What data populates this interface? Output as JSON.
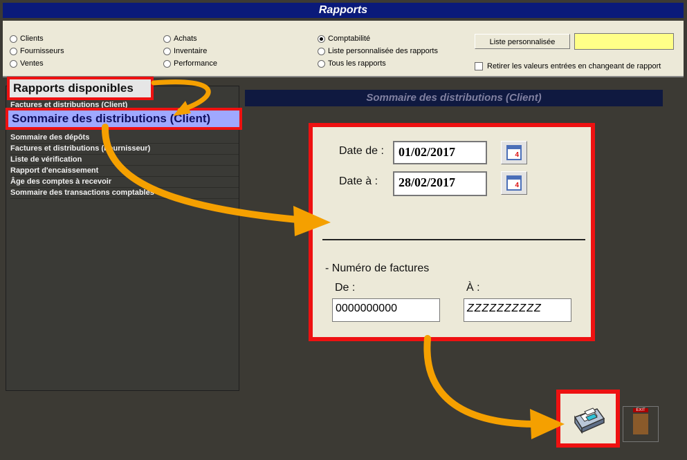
{
  "window": {
    "title": "Rapports"
  },
  "filters": {
    "radios": [
      {
        "label": "Clients",
        "selected": false
      },
      {
        "label": "Fournisseurs",
        "selected": false
      },
      {
        "label": "Ventes",
        "selected": false
      },
      {
        "label": "Achats",
        "selected": false
      },
      {
        "label": "Inventaire",
        "selected": false
      },
      {
        "label": "Performance",
        "selected": false
      },
      {
        "label": "Comptabilité",
        "selected": true
      },
      {
        "label": "Liste personnalisée des rapports",
        "selected": false
      },
      {
        "label": "Tous les rapports",
        "selected": false
      }
    ],
    "custom_list_button": "Liste personnalisée",
    "custom_input_value": "",
    "retain_checkbox_label": "Retirer les valeurs entrées en changeant de rapport"
  },
  "reports": {
    "header_label": "Rapports disponibles",
    "selected_label": "Sommaire des distributions (Client)",
    "items": [
      "Factures et distributions (Client)",
      "Sommaire des dépôts",
      "Factures et distributions (Fournisseur)",
      "Liste de vérification",
      "Rapport d'encaissement",
      "Âge des comptes à recevoir",
      "Sommaire des transactions comptables"
    ]
  },
  "detail": {
    "title": "Sommaire des distributions (Client)",
    "date_from_label": "Date de :",
    "date_from_value": "01/02/2017",
    "date_to_label": "Date à :",
    "date_to_value": "28/02/2017",
    "calendar_badge": "4",
    "invoice_section_label": "- Numéro de factures",
    "invoice_from_label": "De :",
    "invoice_from_value": "0000000000",
    "invoice_to_label": "À :",
    "invoice_to_value": "ZZZZZZZZZZ"
  },
  "actions": {
    "exit_label": "EXIT"
  },
  "colors": {
    "annotation_red": "#e11111",
    "arrow_orange": "#f5a000",
    "titlebar_blue": "#0a1a7a",
    "selected_item": "#9fa8ff"
  }
}
